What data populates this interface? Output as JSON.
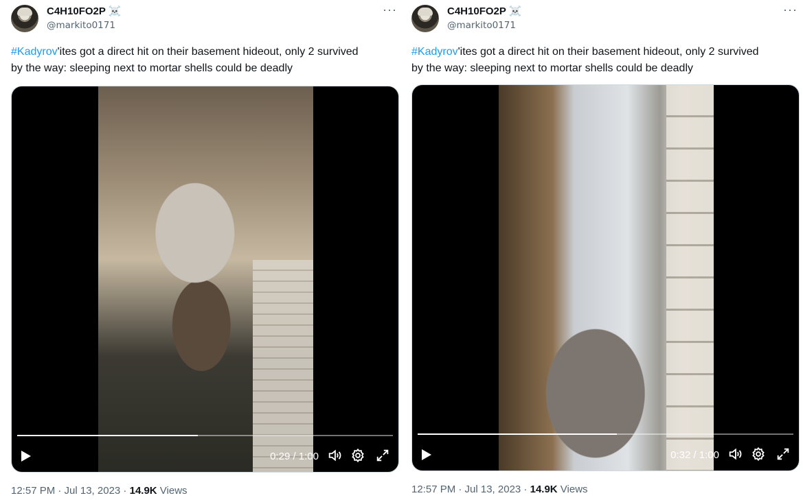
{
  "tweets": [
    {
      "display_name": "C4H10FO2P",
      "badge_icon": "skull-crossbones-icon",
      "badge_glyph": "☠️",
      "handle": "@markito0171",
      "more_glyph": "···",
      "hashtag": "#Kadyrov",
      "text_rest_line1": "'ites got a direct hit on their basement hideout, only 2 survived",
      "text_line2": "by the way: sleeping next to mortar shells could be deadly",
      "video": {
        "time": "0:29 / 1:00",
        "progress": 0.48
      },
      "timestamp": "12:57 PM · Jul 13, 2023 · ",
      "views_count": "14.9K",
      "views_label": " Views"
    },
    {
      "display_name": "C4H10FO2P",
      "badge_icon": "skull-crossbones-icon",
      "badge_glyph": "☠️",
      "handle": "@markito0171",
      "more_glyph": "···",
      "hashtag": "#Kadyrov",
      "text_rest_line1": "'ites got a direct hit on their basement hideout, only 2 survived",
      "text_line2": "by the way: sleeping next to mortar shells could be deadly",
      "video": {
        "time": "0:32 / 1:00",
        "progress": 0.53
      },
      "timestamp": "12:57 PM · Jul 13, 2023 · ",
      "views_count": "14.9K",
      "views_label": " Views"
    }
  ],
  "colors": {
    "link": "#1d9bf0",
    "secondary_text": "#536471",
    "primary_text": "#0f1419"
  }
}
